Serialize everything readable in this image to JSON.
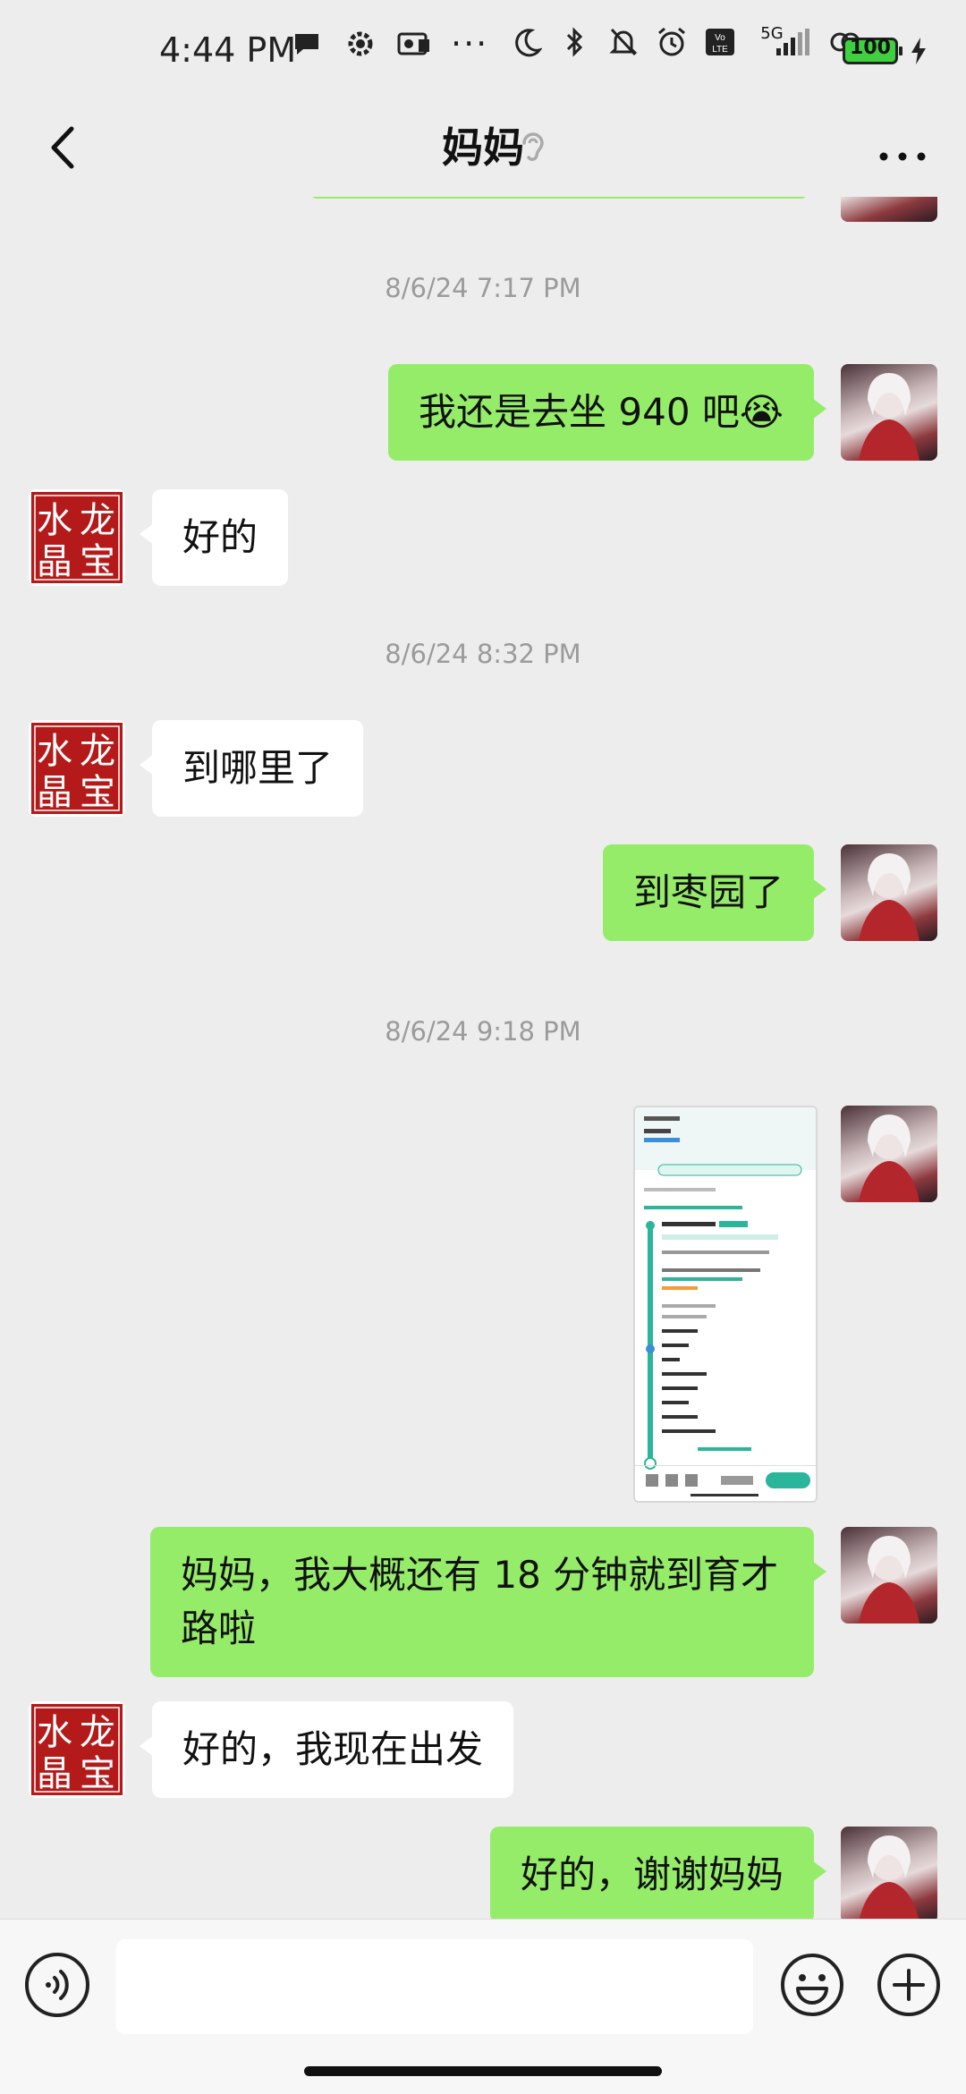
{
  "status_bar": {
    "time": "4:44 PM",
    "network": "5G",
    "battery": "100",
    "dots": "···"
  },
  "header": {
    "title": "妈妈",
    "back_icon": "chevron-left-icon",
    "earpiece_icon": "ear-icon",
    "more_icon": "more-icon"
  },
  "avatars": {
    "mom_text": [
      "水",
      "龙",
      "晶",
      "宝"
    ]
  },
  "messages": [
    {
      "type": "timestamp",
      "text": "8/6/24 7:17 PM"
    },
    {
      "type": "me",
      "text": "我还是去坐 940 吧😭"
    },
    {
      "type": "them",
      "text": "好的"
    },
    {
      "type": "timestamp",
      "text": "8/6/24 8:32 PM"
    },
    {
      "type": "them",
      "text": "到哪里了"
    },
    {
      "type": "me",
      "text": "到枣园了"
    },
    {
      "type": "timestamp",
      "text": "8/6/24 9:18 PM"
    },
    {
      "type": "me_image",
      "alt": "bus-route-screenshot"
    },
    {
      "type": "me",
      "text": "妈妈，我大概还有 18 分钟就到育才路啦"
    },
    {
      "type": "them",
      "text": "好的，我现在出发"
    },
    {
      "type": "me",
      "text": "好的，谢谢妈妈"
    }
  ],
  "input": {
    "value": "",
    "placeholder": ""
  },
  "colors": {
    "me_bubble": "#95ec69",
    "them_bubble": "#ffffff",
    "background": "#ededed"
  }
}
